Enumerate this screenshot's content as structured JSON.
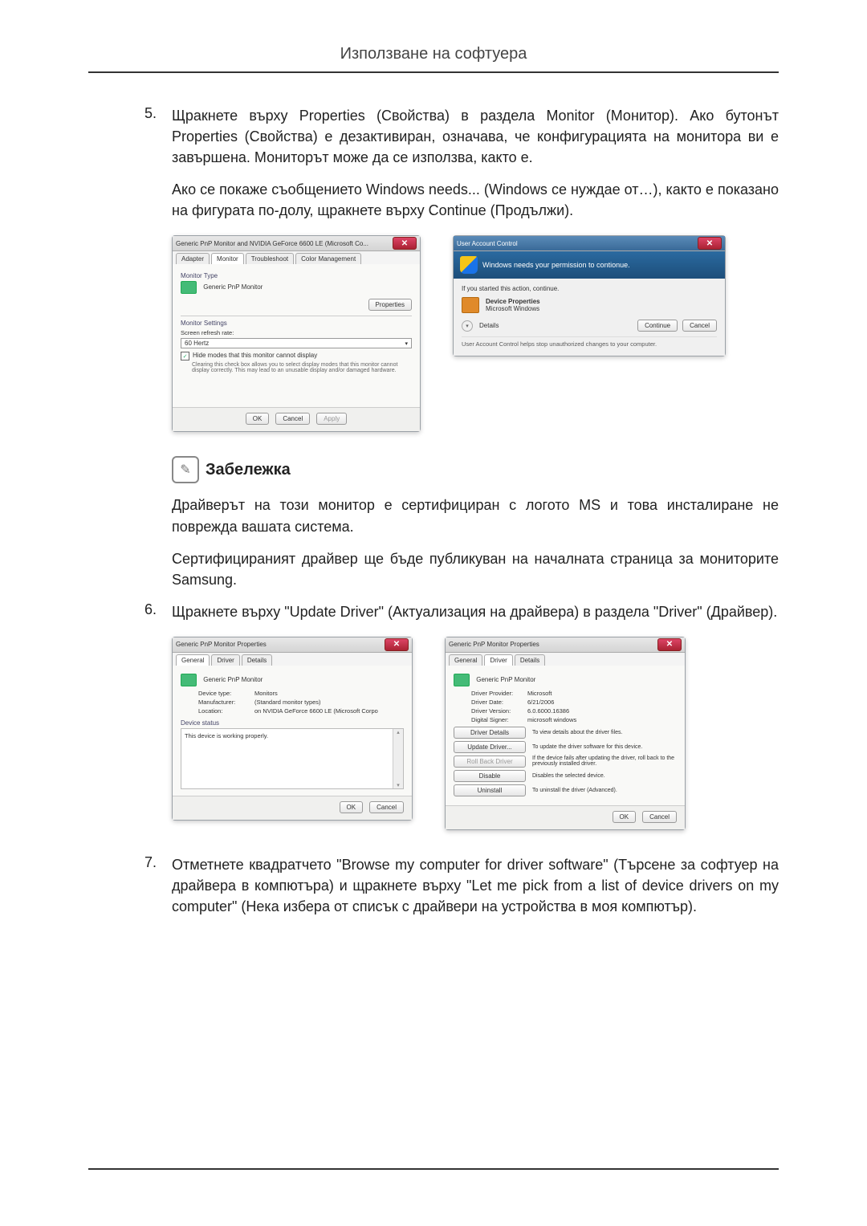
{
  "header": {
    "title": "Използване на софтуера"
  },
  "steps": {
    "s5": {
      "num": "5.",
      "p1": "Щракнете върху Properties (Свойства) в раздела Monitor (Монитор). Ако бутонът Properties (Свойства) е дезактивиран, означава, че конфигурацията на монитора ви е завършена. Мониторът може да се използва, както е.",
      "p2": "Ако се покаже съобщението Windows needs... (Windows се нуждае от…), както е показано на фигурата по-долу, щракнете върху Continue (Продължи)."
    },
    "s6": {
      "num": "6.",
      "p1": "Щракнете върху \"Update Driver\" (Актуализация на драйвера) в раздела \"Driver\" (Драйвер)."
    },
    "s7": {
      "num": "7.",
      "p1": "Отметнете квадратчето \"Browse my computer for driver software\" (Търсене за софтуер на драйвера в компютъра) и щракнете върху \"Let me pick from a list of device drivers on my computer\" (Нека избера от списък с драйвери на устройства в моя компютър)."
    }
  },
  "note": {
    "title": "Забележка",
    "p1": "Драйверът на този монитор е сертифициран с логото MS и това инсталиране не поврежда вашата система.",
    "p2": "Сертифицираният драйвер ще бъде публикуван на началната страница за мониторите Samsung."
  },
  "fig1": {
    "win_title": "Generic PnP Monitor and NVIDIA GeForce 6600 LE (Microsoft Co...",
    "tabs": [
      "Adapter",
      "Monitor",
      "Troubleshoot",
      "Color Management"
    ],
    "active_tab_index": 1,
    "monitor_type_label": "Monitor Type",
    "monitor_type_value": "Generic PnP Monitor",
    "properties_btn": "Properties",
    "settings_label": "Monitor Settings",
    "refresh_label": "Screen refresh rate:",
    "refresh_value": "60 Hertz",
    "hide_modes_label": "Hide modes that this monitor cannot display",
    "hide_modes_desc": "Clearing this check box allows you to select display modes that this monitor cannot display correctly. This may lead to an unusable display and/or damaged hardware.",
    "ok": "OK",
    "cancel": "Cancel",
    "apply": "Apply"
  },
  "fig2": {
    "win_title": "User Account Control",
    "headline": "Windows needs your permission to contionue.",
    "sub": "If you started this action, continue.",
    "prog_name": "Device Properties",
    "prog_pub": "Microsoft Windows",
    "details": "Details",
    "continue": "Continue",
    "cancel": "Cancel",
    "footer": "User Account Control helps stop unauthorized changes to your computer."
  },
  "fig3": {
    "win_title": "Generic PnP Monitor Properties",
    "tabs": [
      "General",
      "Driver",
      "Details"
    ],
    "active_tab_index": 0,
    "device_name": "Generic PnP Monitor",
    "rows": {
      "device_type_label": "Device type:",
      "device_type_value": "Monitors",
      "manufacturer_label": "Manufacturer:",
      "manufacturer_value": "(Standard monitor types)",
      "location_label": "Location:",
      "location_value": "on NVIDIA GeForce 6600 LE (Microsoft Corpo"
    },
    "status_label": "Device status",
    "status_text": "This device is working properly.",
    "ok": "OK",
    "cancel": "Cancel"
  },
  "fig4": {
    "win_title": "Generic PnP Monitor Properties",
    "tabs": [
      "General",
      "Driver",
      "Details"
    ],
    "active_tab_index": 1,
    "device_name": "Generic PnP Monitor",
    "rows": {
      "provider_label": "Driver Provider:",
      "provider_value": "Microsoft",
      "date_label": "Driver Date:",
      "date_value": "6/21/2006",
      "version_label": "Driver Version:",
      "version_value": "6.0.6000.16386",
      "signer_label": "Digital Signer:",
      "signer_value": "microsoft windows"
    },
    "buttons": {
      "details_btn": "Driver Details",
      "details_desc": "To view details about the driver files.",
      "update_btn": "Update Driver...",
      "update_desc": "To update the driver software for this device.",
      "rollback_btn": "Roll Back Driver",
      "rollback_desc": "If the device fails after updating the driver, roll back to the previously installed driver.",
      "disable_btn": "Disable",
      "disable_desc": "Disables the selected device.",
      "uninstall_btn": "Uninstall",
      "uninstall_desc": "To uninstall the driver (Advanced)."
    },
    "ok": "OK",
    "cancel": "Cancel"
  }
}
